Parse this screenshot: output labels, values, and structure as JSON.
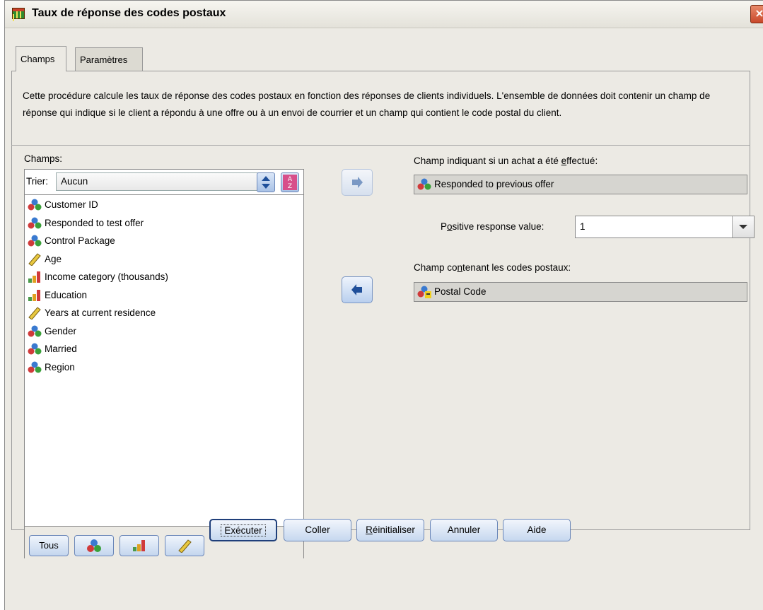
{
  "window": {
    "title": "Taux de réponse des codes postaux",
    "close_icon": "×"
  },
  "tabs": [
    {
      "label": "Champs"
    },
    {
      "label": "Paramètres"
    }
  ],
  "description": "Cette procédure calcule les taux de réponse des codes postaux en fonction des réponses de clients individuels. L'ensemble de données doit contenir un champ de réponse qui indique si le client a répondu à une offre ou à un envoi de courrier et un champ qui contient le code postal du client.",
  "fields_panel": {
    "label": "Champs:",
    "sort_label": "Trier:",
    "sort_value": "Aucun",
    "items": [
      {
        "label": "Customer ID",
        "icon": "nominal"
      },
      {
        "label": "Responded to test offer",
        "icon": "nominal"
      },
      {
        "label": "Control Package",
        "icon": "nominal"
      },
      {
        "label": "Age",
        "icon": "scale"
      },
      {
        "label": "Income category (thousands)",
        "icon": "ordinal"
      },
      {
        "label": "Education",
        "icon": "ordinal"
      },
      {
        "label": "Years at current residence",
        "icon": "scale"
      },
      {
        "label": "Gender",
        "icon": "nominal"
      },
      {
        "label": "Married",
        "icon": "nominal"
      },
      {
        "label": "Region",
        "icon": "nominal"
      }
    ],
    "filter_buttons": {
      "all_label": "Tous"
    }
  },
  "purchase_field": {
    "label_pre": "Champ indiquant si un achat a été ",
    "label_u": "e",
    "label_post": "ffectué:",
    "value": "Responded to previous offer"
  },
  "positive_value": {
    "label_pre": "P",
    "label_u": "o",
    "label_post": "sitive response value:",
    "value": "1"
  },
  "postal_field": {
    "label_pre": "Champ co",
    "label_u": "n",
    "label_post": "tenant les codes postaux:",
    "value": "Postal Code"
  },
  "buttons": {
    "run": "Exécuter",
    "paste": "Coller",
    "reset_u": "R",
    "reset_rest": "éinitialiser",
    "cancel": "Annuler",
    "help": "Aide"
  },
  "colors": {
    "dialog_bg": "#eceae4",
    "button_blue": "#c4d6ee",
    "field_bg": "#d6d5d0"
  }
}
